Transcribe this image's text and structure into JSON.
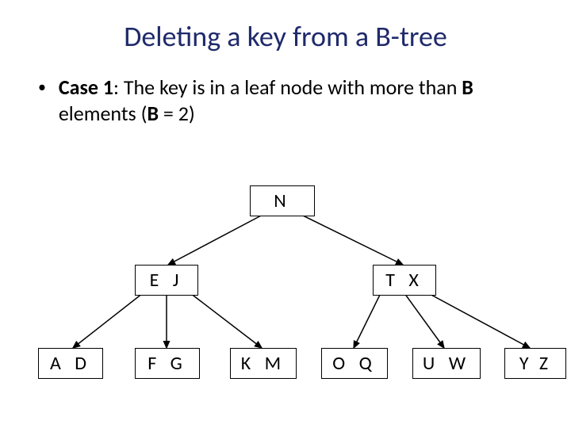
{
  "title": "Deleting a key from a B-tree",
  "bullet": {
    "case_label": "Case 1",
    "text_before": ": The key is in a leaf node with more than ",
    "B1": "B",
    "text_mid": " elements (",
    "B2": "B",
    "text_after": " = 2)"
  },
  "tree": {
    "root": "N",
    "level1": {
      "left": "E  J",
      "right": "T  X"
    },
    "leaves": {
      "ad": "A  D",
      "fg": "F  G",
      "km": "K  M",
      "oq": "O  Q",
      "uw": "U  W",
      "yz": "Y  Z"
    }
  }
}
